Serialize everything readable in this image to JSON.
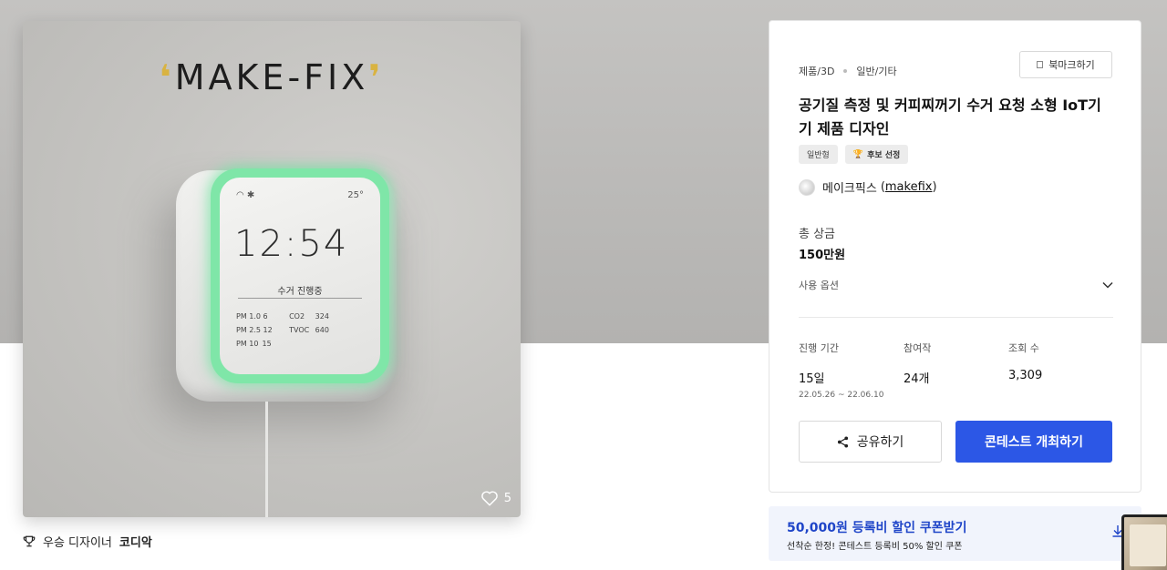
{
  "product": {
    "brand_logo": "MAKE-FIX",
    "device_screen": {
      "temperature": "25°",
      "time": "12:54",
      "status": "수거 진행중",
      "metrics": [
        [
          "PM 1.0",
          "6",
          "CO2",
          "324"
        ],
        [
          "PM 2.5",
          "12",
          "TVOC",
          "640"
        ],
        [
          "PM 10",
          "15",
          "",
          ""
        ]
      ]
    },
    "likes": "5"
  },
  "award": {
    "label": "우승 디자이너",
    "name": "코디악"
  },
  "info": {
    "category": "제품/3D",
    "subcategory": "일반/기타",
    "bookmark_label": "북마크하기",
    "title": "공기질 측정 및 커피찌꺼기 수거 요청 소형 IoT기기 제품 디자인",
    "badges": {
      "type": "일반형",
      "featured": "후보 선정"
    },
    "author": {
      "name": "메이크픽스",
      "handle": "makefix"
    },
    "prize_label": "총 상금",
    "prize_value": "150만원",
    "usage_label": "사용 옵션",
    "stats": {
      "period_label": "진행 기간",
      "period_value": "15일",
      "period_range": "22.05.26 ~ 22.06.10",
      "participants_label": "참여작",
      "participants_value": "24개",
      "views_label": "조회 수",
      "views_value": "3,309"
    },
    "share_label": "공유하기",
    "host_label": "콘테스트 개최하기"
  },
  "coupon": {
    "title": "50,000원 등록비 할인 쿠폰받기",
    "subtitle": "선착순 한정! 콘테스트 등록비 50% 할인 쿠폰"
  },
  "colors": {
    "accent": "#2c57e6",
    "coupon_text": "#1f45c8",
    "glow": "#7fe6a8"
  }
}
